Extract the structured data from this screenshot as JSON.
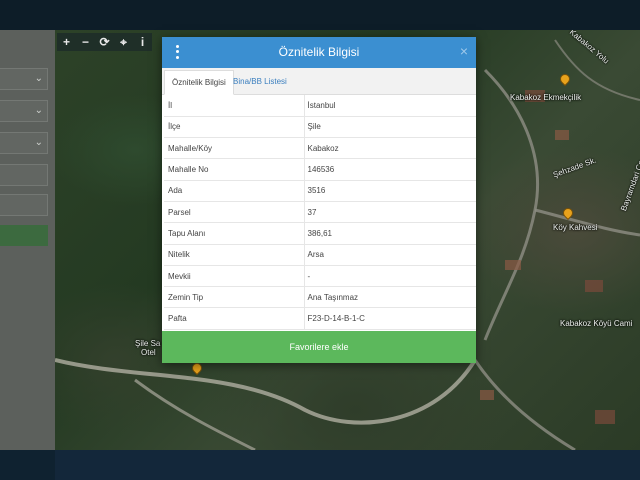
{
  "map": {
    "tools": [
      {
        "icon": "+",
        "name": "zoom-in"
      },
      {
        "icon": "−",
        "name": "zoom-out"
      },
      {
        "icon": "⟳",
        "name": "refresh"
      },
      {
        "icon": "⌖",
        "name": "locate"
      },
      {
        "icon": "i",
        "name": "info"
      }
    ],
    "labels": {
      "kabakoz_yolu": "Kabakoz Yolu",
      "ekmekcilik": "Kabakoz Ekmekçilik",
      "sehzade": "Şehzade Sk.",
      "bayrak": "Bayramdari Çe.",
      "koy_kahvesi": "Köy Kahvesi",
      "koyu_cami": "Kabakoz Köyü Cami",
      "sile_otel_1": "Şile Sa",
      "sile_otel_2": "Otel"
    }
  },
  "modal": {
    "title": "Öznitelik Bilgisi",
    "close": "×",
    "tabs": [
      "Öznitelik Bilgisi",
      "Bina/BB Listesi"
    ],
    "rows": [
      {
        "key": "İl",
        "value": "İstanbul"
      },
      {
        "key": "İlçe",
        "value": "Şile"
      },
      {
        "key": "Mahalle/Köy",
        "value": "Kabakoz"
      },
      {
        "key": "Mahalle No",
        "value": "146536"
      },
      {
        "key": "Ada",
        "value": "3516"
      },
      {
        "key": "Parsel",
        "value": "37"
      },
      {
        "key": "Tapu Alanı",
        "value": "386,61"
      },
      {
        "key": "Nitelik",
        "value": "Arsa"
      },
      {
        "key": "Mevkii",
        "value": "-"
      },
      {
        "key": "Zemin Tip",
        "value": "Ana Taşınmaz"
      },
      {
        "key": "Pafta",
        "value": "F23-D-14-B-1-C"
      }
    ],
    "favorite_label": "Favorilere ekle"
  },
  "colors": {
    "header": "#3b8fd1",
    "favorite": "#5cb85c",
    "tab_link": "#3b7fbf"
  }
}
